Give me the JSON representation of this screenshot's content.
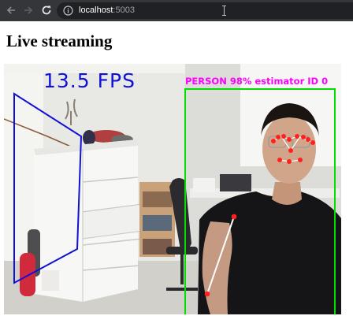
{
  "browser": {
    "back_icon": "arrow-left-icon",
    "forward_icon": "arrow-right-icon",
    "reload_icon": "reload-icon",
    "info_icon": "info-circle-icon",
    "url_host": "localhost",
    "url_port": ":5003"
  },
  "page": {
    "title": "Live streaming"
  },
  "stream": {
    "fps_label": "13.5 FPS",
    "detection_label": "PERSON 98% estimator ID 0",
    "colors": {
      "fps": "#1010d8",
      "cabinet_box": "#1010d8",
      "person_box": "#00e000",
      "label": "#ff00ff",
      "keypoints": "#ff2020",
      "skeleton": "#ffffff"
    }
  }
}
